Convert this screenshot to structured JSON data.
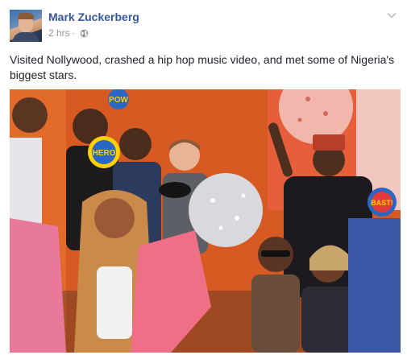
{
  "post": {
    "author": "Mark Zuckerberg",
    "timestamp": "2 hrs",
    "separator": "·",
    "privacy_icon": "globe-icon",
    "menu_icon": "chevron-down-icon",
    "text": "Visited Nollywood, crashed a hip hop music video, and met some of Nigeria's biggest stars.",
    "photo": {
      "description_icon": "group-photo",
      "props": {
        "sign1": "POW",
        "sign2": "HERO",
        "sign3": "BAST!"
      }
    }
  },
  "colors": {
    "link_blue": "#365899",
    "meta_gray": "#90949c",
    "text_dark": "#1d2129",
    "backdrop_orange": "#d8571f"
  }
}
